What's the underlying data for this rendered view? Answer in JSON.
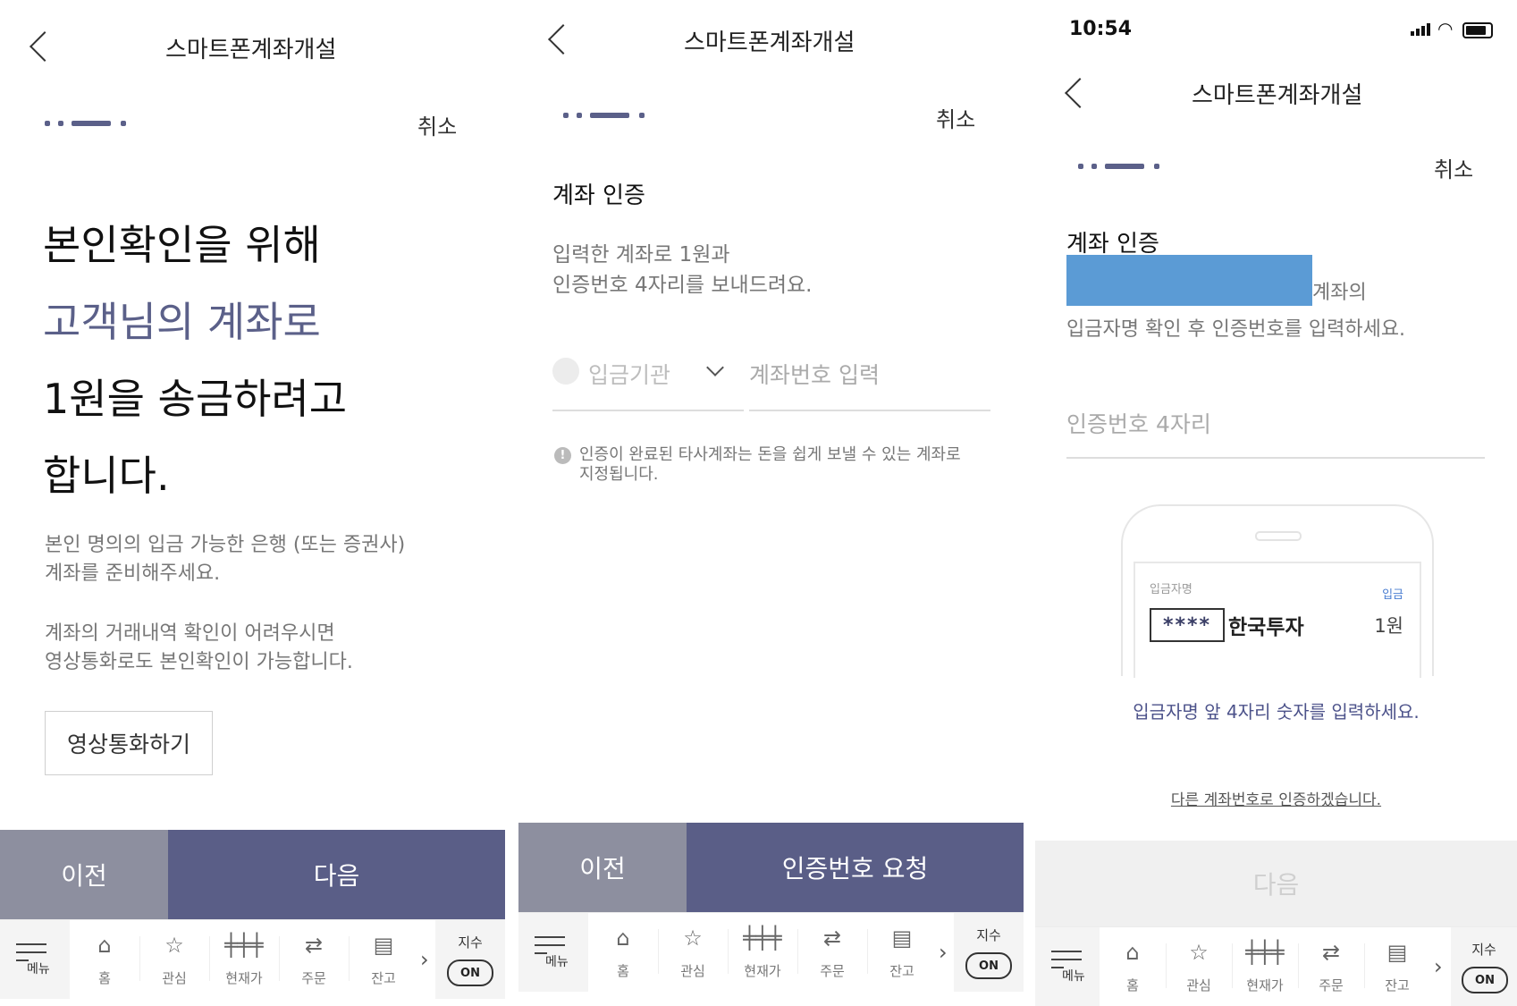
{
  "common": {
    "header_title": "스마트폰계좌개설",
    "cancel_label": "취소",
    "prev_label": "이전",
    "tabbar": {
      "menu": "메뉴",
      "home": "홈",
      "watch": "관심",
      "price": "현재가",
      "order": "주문",
      "balance": "잔고",
      "index": "지수",
      "on": "ON"
    }
  },
  "screen1": {
    "headline1": "본인확인을 위해",
    "headline2": "고객님의 계좌로",
    "headline3": "1원을 송금하려고",
    "headline4": "합니다.",
    "desc1_line1": "본인 명의의 입금 가능한 은행 (또는 증권사)",
    "desc1_line2": "계좌를 준비해주세요.",
    "desc2_line1": "계좌의 거래내역 확인이 어려우시면",
    "desc2_line2": "영상통화로도 본인확인이 가능합니다.",
    "video_call_button": "영상통화하기",
    "next_label": "다음"
  },
  "screen2": {
    "section_title": "계좌 인증",
    "desc_line1": "입력한 계좌로 1원과",
    "desc_line2": "인증번호 4자리를 보내드려요.",
    "bank_placeholder": "입금기관",
    "account_placeholder": "계좌번호 입력",
    "notice_line1": "인증이 완료된 타사계좌는 돈을 쉽게 보낼 수 있는 계좌로",
    "notice_line2": "지정됩니다.",
    "request_label": "인증번호 요청"
  },
  "screen3": {
    "status_time": "10:54",
    "section_title": "계좌 인증",
    "desc_tail": "계좌의",
    "desc_line2": "입금자명 확인 후 인증번호를 입력하세요.",
    "code_placeholder": "인증번호 4자리",
    "card_sender_label": "입금자명",
    "card_deposit_label": "입금",
    "card_masked": "****",
    "card_name": "한국투자",
    "card_amount": "1원",
    "hint": "입금자명 앞 4자리 숫자를 입력하세요.",
    "other_account_link": "다른 계좌번호로 인증하겠습니다.",
    "next_label": "다음",
    "redaction_color": "#5b9bd5"
  },
  "colors": {
    "accent": "#5a5e87",
    "prev_button": "#8d8f9f"
  }
}
